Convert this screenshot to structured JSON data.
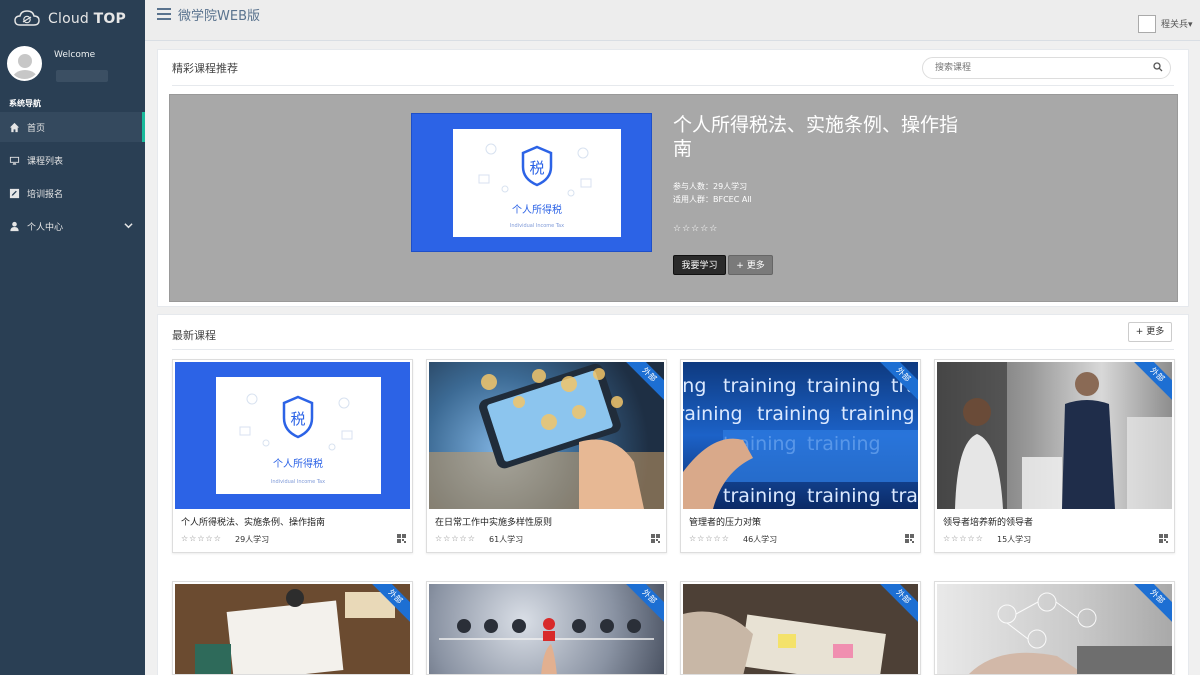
{
  "sidebar": {
    "brand_name": "Cloud",
    "brand_bold": "TOP",
    "welcome": "Welcome",
    "nav_heading": "系统导航",
    "items": [
      {
        "label": "首页",
        "icon": "home-icon",
        "active": true
      },
      {
        "label": "课程列表",
        "icon": "monitor-icon"
      },
      {
        "label": "培训报名",
        "icon": "edit-icon"
      },
      {
        "label": "个人中心",
        "icon": "user-icon"
      }
    ]
  },
  "topbar": {
    "title": "微学院WEB版",
    "user_name": "程关兵"
  },
  "featured": {
    "heading": "精彩课程推荐",
    "search_placeholder": "搜索课程",
    "course": {
      "title": "个人所得税法、实施条例、操作指南",
      "participants": "参与人数：29人学习",
      "audience": "适用人群：BFCEC All",
      "stars": "☆☆☆☆☆",
      "study_button": "我要学习",
      "more_button": "+ 更多",
      "thumb_title": "个人所得税",
      "thumb_subtitle": "Individual Income Tax",
      "thumb_glyph": "税"
    }
  },
  "latest": {
    "heading": "最新课程",
    "more_button": "+ 更多",
    "ribbon_text": "外部",
    "cards": [
      {
        "title": "个人所得税法、实施条例、操作指南",
        "stars": "☆☆☆☆☆",
        "count": "29人学习",
        "thumb": "tax",
        "thumb_title": "个人所得税",
        "thumb_subtitle": "Individual Income Tax",
        "thumb_glyph": "税"
      },
      {
        "title": "在日常工作中实施多样性原则",
        "stars": "☆☆☆☆☆",
        "count": "61人学习",
        "thumb": "phone"
      },
      {
        "title": "管理者的压力对策",
        "stars": "☆☆☆☆☆",
        "count": "46人学习",
        "thumb": "training"
      },
      {
        "title": "领导者培养新的领导者",
        "stars": "☆☆☆☆☆",
        "count": "15人学习",
        "thumb": "office"
      }
    ],
    "training_words": [
      "ing",
      "training",
      "training",
      "trai",
      "training",
      "training",
      "training",
      "training",
      "training",
      "training",
      "training",
      "trai"
    ]
  },
  "colors": {
    "sidebar_bg": "#2a3f54",
    "accent": "#1abb9c",
    "ribbon": "#1d6fd3",
    "tax_blue": "#2c63e6"
  }
}
